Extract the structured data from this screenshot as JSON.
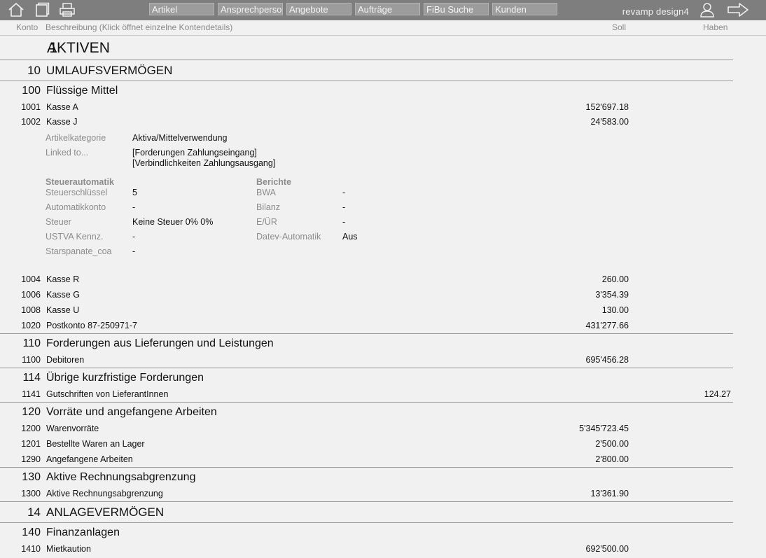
{
  "toolbar": {
    "icons": [
      "home-icon",
      "window-icon",
      "printer-icon"
    ],
    "tabs": [
      "Artikel",
      "Ansprechpersonen",
      "Angebote",
      "Aufträge",
      "FiBu Suche",
      "Kunden"
    ],
    "brand": "revamp design4",
    "right_icons": [
      "user-icon",
      "logout-arrow-icon"
    ]
  },
  "columns": {
    "konto": "Konto",
    "beschreibung": "Beschreibung (Klick öffnet einzelne Kontendetails)",
    "soll": "Soll",
    "haben": "Haben"
  },
  "sections": {
    "s1": {
      "num": "1",
      "title": "AKTIVEN"
    },
    "s10": {
      "num": "10",
      "title": "UMLAUFSVERMÖGEN"
    },
    "s100": {
      "num": "100",
      "title": "Flüssige Mittel"
    },
    "s110": {
      "num": "110",
      "title": "Forderungen aus Lieferungen und Leistungen"
    },
    "s114": {
      "num": "114",
      "title": "Übrige kurzfristige Forderungen"
    },
    "s120": {
      "num": "120",
      "title": "Vorräte und angefangene Arbeiten"
    },
    "s130": {
      "num": "130",
      "title": "Aktive Rechnungsabgrenzung"
    },
    "s14": {
      "num": "14",
      "title": "ANLAGEVERMÖGEN"
    },
    "s140": {
      "num": "140",
      "title": "Finanzanlagen"
    }
  },
  "accounts": {
    "a1001": {
      "num": "1001",
      "name": "Kasse A",
      "soll": "152'697.18",
      "haben": ""
    },
    "a1002": {
      "num": "1002",
      "name": "Kasse J",
      "soll": "24'583.00",
      "haben": ""
    },
    "a1004": {
      "num": "1004",
      "name": "Kasse R",
      "soll": "260.00",
      "haben": ""
    },
    "a1006": {
      "num": "1006",
      "name": "Kasse G",
      "soll": "3'354.39",
      "haben": ""
    },
    "a1008": {
      "num": "1008",
      "name": "Kasse U",
      "soll": "130.00",
      "haben": ""
    },
    "a1020": {
      "num": "1020",
      "name": "Postkonto 87-250971-7",
      "soll": "431'277.66",
      "haben": ""
    },
    "a1100": {
      "num": "1100",
      "name": "Debitoren",
      "soll": "695'456.28",
      "haben": ""
    },
    "a1141": {
      "num": "1141",
      "name": "Gutschriften von LieferantInnen",
      "soll": "",
      "haben": "124.27"
    },
    "a1200": {
      "num": "1200",
      "name": "Warenvorräte",
      "soll": "5'345'723.45",
      "haben": ""
    },
    "a1201": {
      "num": "1201",
      "name": "Bestellte Waren an Lager",
      "soll": "2'500.00",
      "haben": ""
    },
    "a1290": {
      "num": "1290",
      "name": "Angefangene Arbeiten",
      "soll": "2'800.00",
      "haben": ""
    },
    "a1300": {
      "num": "1300",
      "name": "Aktive Rechnungsabgrenzung",
      "soll": "13'361.90",
      "haben": ""
    },
    "a1410": {
      "num": "1410",
      "name": "Mietkaution",
      "soll": "692'500.00",
      "haben": ""
    }
  },
  "details": {
    "artikelkategorie_label": "Artikelkategorie",
    "artikelkategorie_value": "Aktiva/Mittelverwendung",
    "linked_label": "Linked to...",
    "linked_1": "[Forderungen Zahlungseingang]",
    "linked_2": "[Verbindlichkeiten Zahlungsausgang]",
    "steuerautomatik_head": "Steuerautomatik",
    "berichte_head": "Berichte",
    "steuerschluessel_label": "Steuerschlüssel",
    "steuerschluessel_value": "5",
    "automatikkonto_label": "Automatikkonto",
    "automatikkonto_value": "-",
    "steuer_label": "Steuer",
    "steuer_value": "Keine Steuer 0% 0%",
    "ustva_label": "USTVA Kennz.",
    "ustva_value": "-",
    "starspanate_label": "Starspanate_coa",
    "starspanate_value": "-",
    "bwa_label": "BWA",
    "bwa_value": "-",
    "bilanz_label": "Bilanz",
    "bilanz_value": "-",
    "eur_label": "E/ÜR",
    "eur_value": "-",
    "datev_label": "Datev-Automatik",
    "datev_value": "Aus"
  }
}
